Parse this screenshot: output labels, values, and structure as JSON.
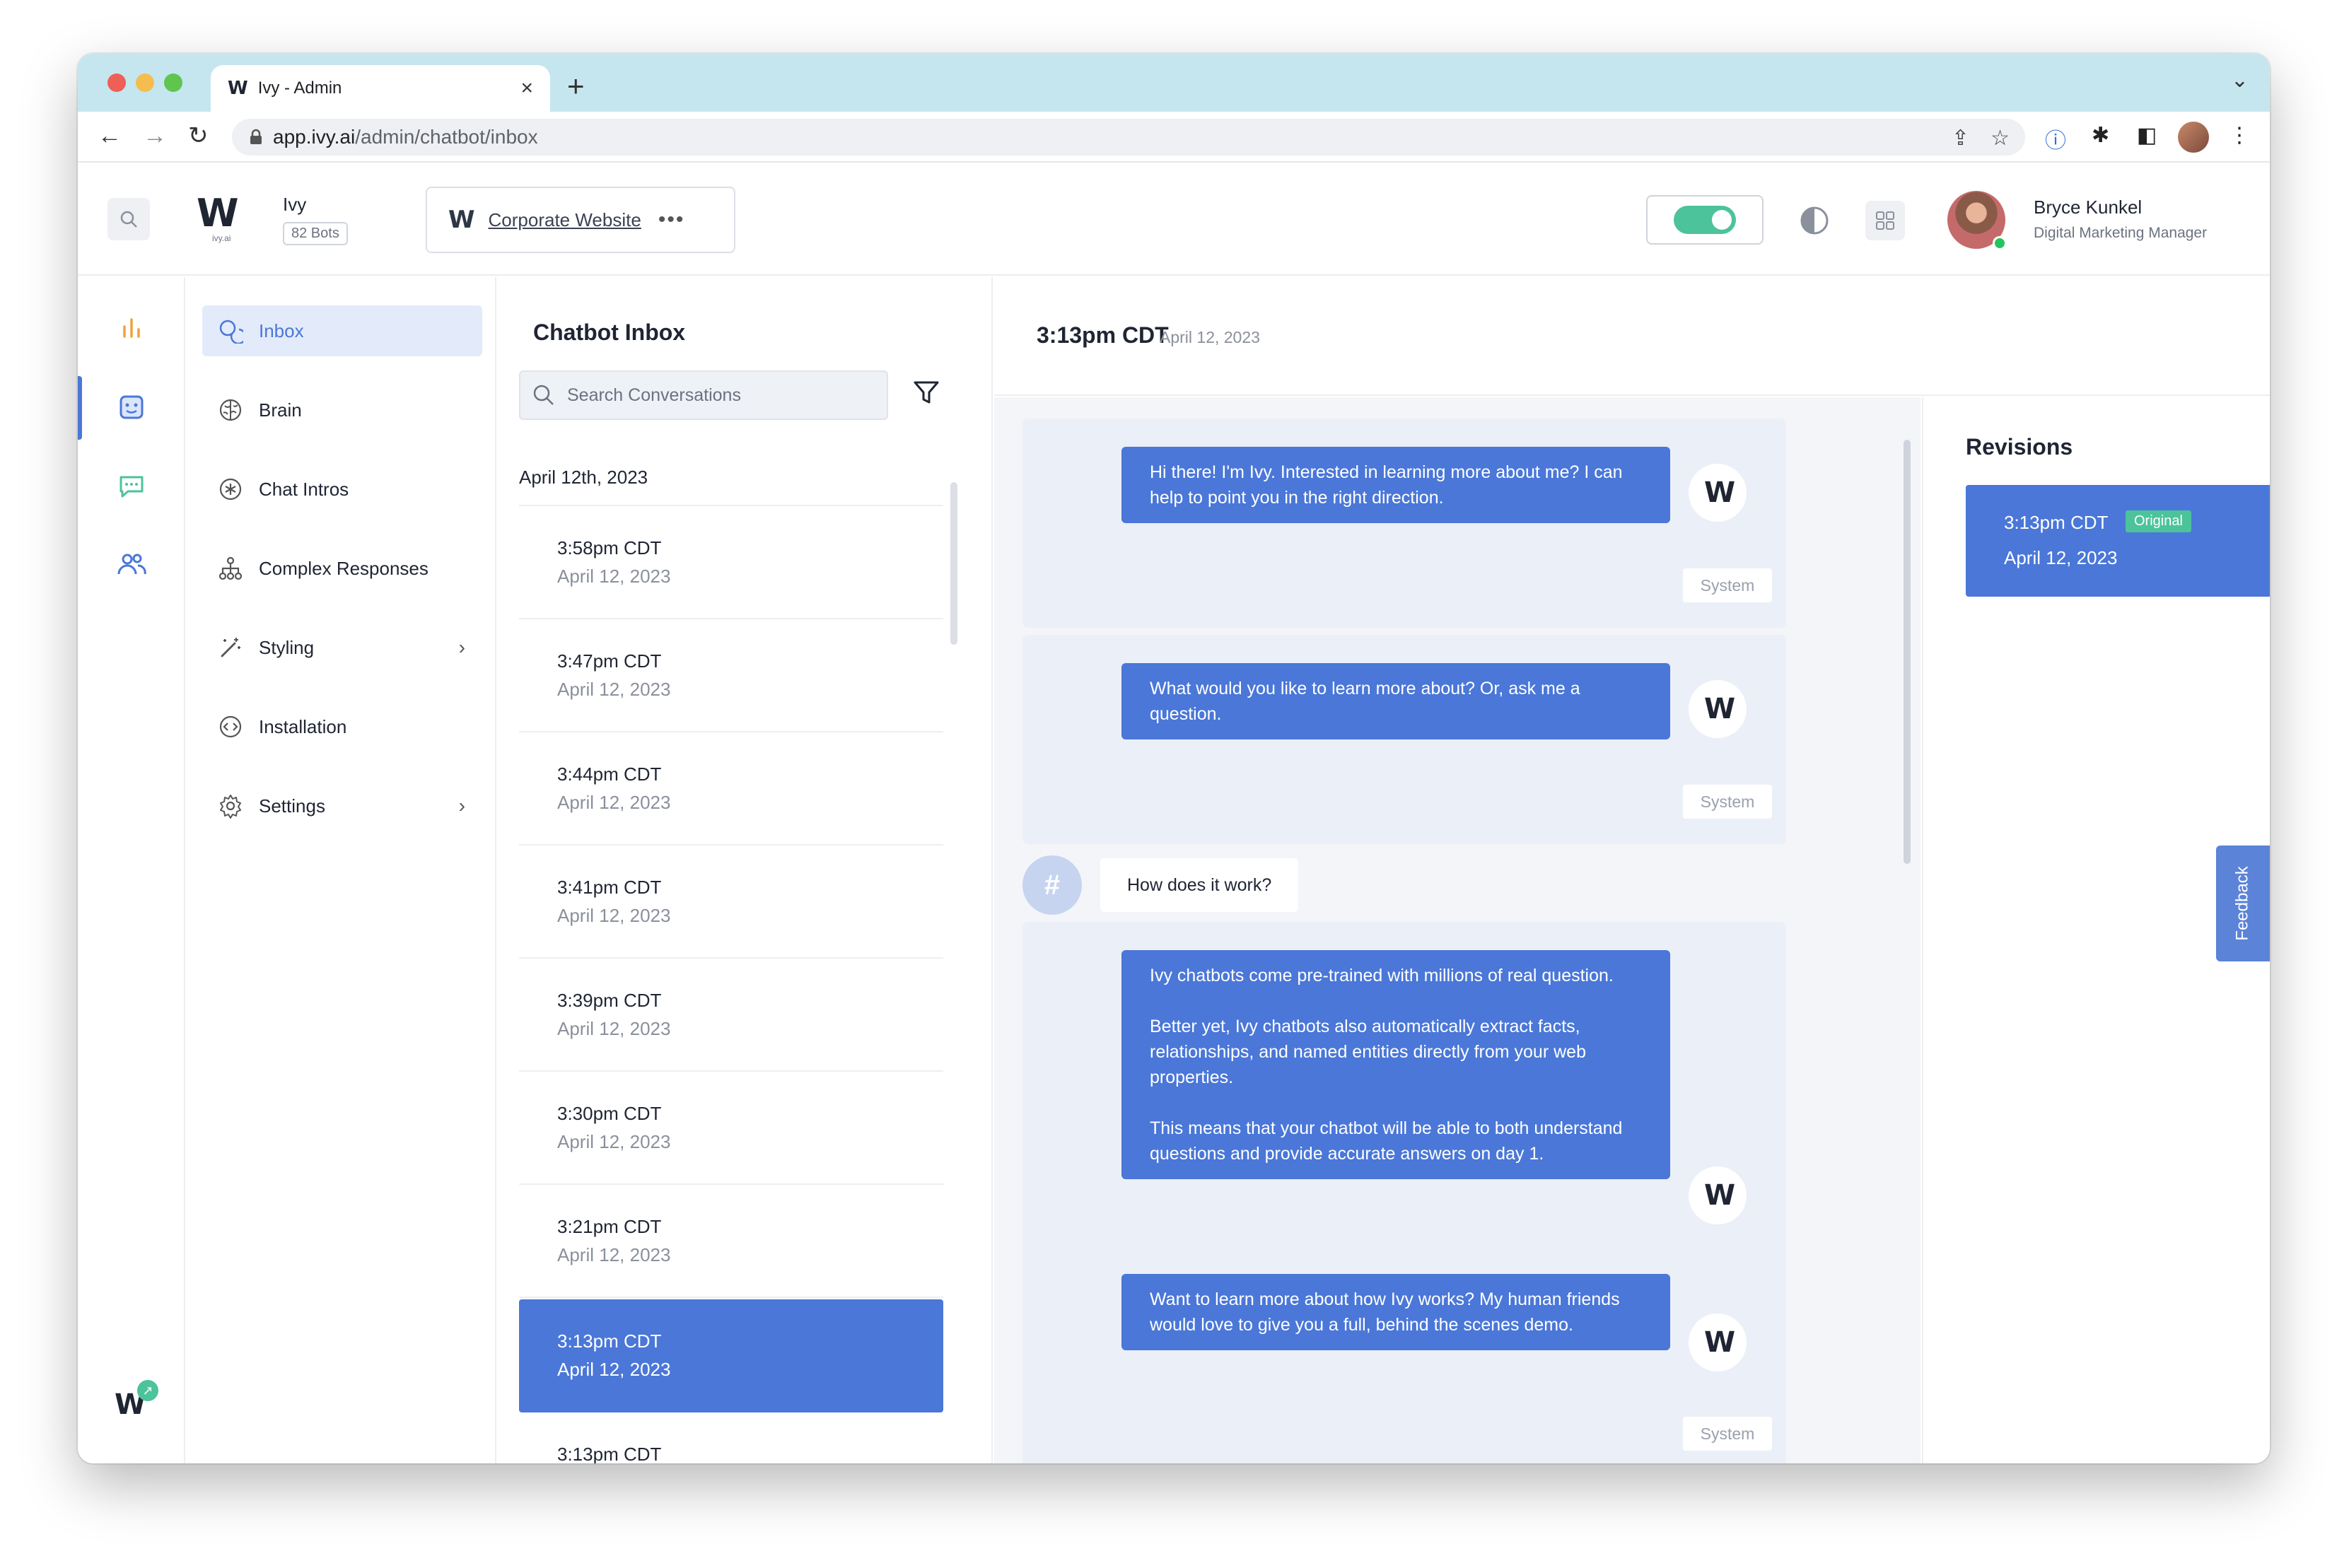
{
  "browser": {
    "tab_title": "Ivy - Admin",
    "url_domain": "app.ivy.ai",
    "url_path": "/admin/chatbot/inbox"
  },
  "header": {
    "brand_name": "Ivy",
    "brand_sub": "ivy.ai",
    "bots_count": "82 Bots",
    "site_name": "Corporate Website",
    "user_name": "Bryce Kunkel",
    "user_role": "Digital Marketing Manager"
  },
  "nav": {
    "items": [
      {
        "label": "Inbox",
        "icon": "inbox-icon"
      },
      {
        "label": "Brain",
        "icon": "brain-icon"
      },
      {
        "label": "Chat Intros",
        "icon": "asterisk-icon"
      },
      {
        "label": "Complex Responses",
        "icon": "hierarchy-icon"
      },
      {
        "label": "Styling",
        "icon": "magic-wand-icon"
      },
      {
        "label": "Installation",
        "icon": "code-icon"
      },
      {
        "label": "Settings",
        "icon": "gear-icon"
      }
    ]
  },
  "inbox": {
    "title": "Chatbot Inbox",
    "search_placeholder": "Search Conversations",
    "group_date": "April 12th, 2023",
    "conversations": [
      {
        "time": "3:58pm CDT",
        "date": "April 12, 2023"
      },
      {
        "time": "3:47pm CDT",
        "date": "April 12, 2023"
      },
      {
        "time": "3:44pm CDT",
        "date": "April 12, 2023"
      },
      {
        "time": "3:41pm CDT",
        "date": "April 12, 2023"
      },
      {
        "time": "3:39pm CDT",
        "date": "April 12, 2023"
      },
      {
        "time": "3:30pm CDT",
        "date": "April 12, 2023"
      },
      {
        "time": "3:21pm CDT",
        "date": "April 12, 2023"
      },
      {
        "time": "3:13pm CDT",
        "date": "April 12, 2023"
      },
      {
        "time": "3:13pm CDT",
        "date": ""
      }
    ]
  },
  "chat": {
    "time": "3:13pm CDT",
    "date": "April 12, 2023",
    "system_label": "System",
    "messages": {
      "m1": "Hi there! I'm Ivy. Interested in learning more about me? I can help to point you in the right direction.",
      "m2": "What would you like to learn more about? Or, ask me a question.",
      "user1": "How does it work?",
      "m3a": "Ivy chatbots come pre-trained with millions of real question.",
      "m3b": "Better yet, Ivy chatbots also automatically extract facts, relationships, and named entities directly from your web properties.",
      "m3c": "This means that your chatbot will be able to both understand questions and provide accurate answers on day 1.",
      "m4": "Want to learn more about how Ivy works? My human friends would love to give you a full, behind the scenes demo."
    },
    "user_avatar_glyph": "#"
  },
  "revisions": {
    "title": "Revisions",
    "card_time": "3:13pm CDT",
    "card_badge": "Original",
    "card_date": "April 12, 2023"
  },
  "feedback_label": "Feedback",
  "colors": {
    "accent": "#4a77d8",
    "success": "#4cc39a",
    "chat_bg": "#f3f5f9"
  }
}
